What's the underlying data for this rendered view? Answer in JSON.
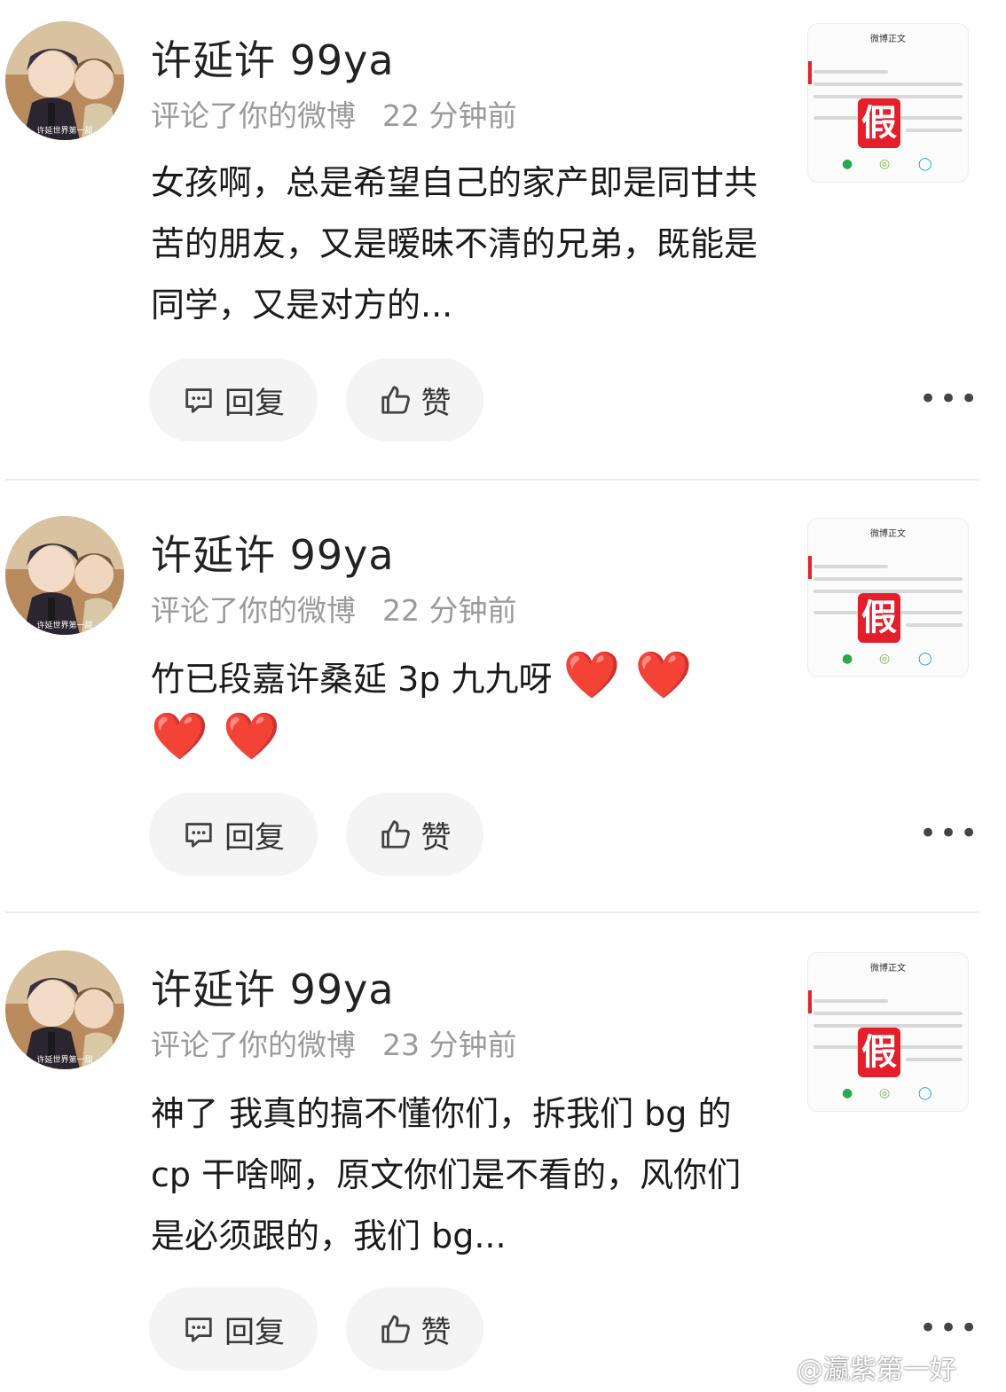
{
  "comments": [
    {
      "username": "许延许 99ya",
      "action": "评论了你的微博",
      "time": "22 分钟前",
      "text": "女孩啊，总是希望自己的家产即是同甘共苦的朋友，又是暧昧不清的兄弟，既能是同学，又是对方的...",
      "avatar_caption": "许延世界第一甜",
      "reply_label": "回复",
      "like_label": "赞",
      "more_label": "•••"
    },
    {
      "username": "许延许 99ya",
      "action": "评论了你的微博",
      "time": "22 分钟前",
      "text": "竹已段嘉许桑延 3p 九九呀",
      "hearts": "❤️ ❤️ ❤️ ❤️",
      "avatar_caption": "许延世界第一甜",
      "reply_label": "回复",
      "like_label": "赞",
      "more_label": "•••"
    },
    {
      "username": "许延许 99ya",
      "action": "评论了你的微博",
      "time": "23 分钟前",
      "text": "神了 我真的搞不懂你们，拆我们 bg 的 cp 干啥啊，原文你们是不看的，风你们是必须跟的，我们 bg...",
      "avatar_caption": "许延世界第一甜",
      "reply_label": "回复",
      "like_label": "赞",
      "more_label": "•••"
    }
  ],
  "thumbnail": {
    "title": "微博正文",
    "stamp": "假"
  },
  "watermark": "@瀛紫第一好",
  "colors": {
    "stamp_red": "#e41e2b",
    "heart_red": "#e8262b",
    "meta_gray": "#9a9a9a",
    "button_bg": "#f4f4f4"
  }
}
